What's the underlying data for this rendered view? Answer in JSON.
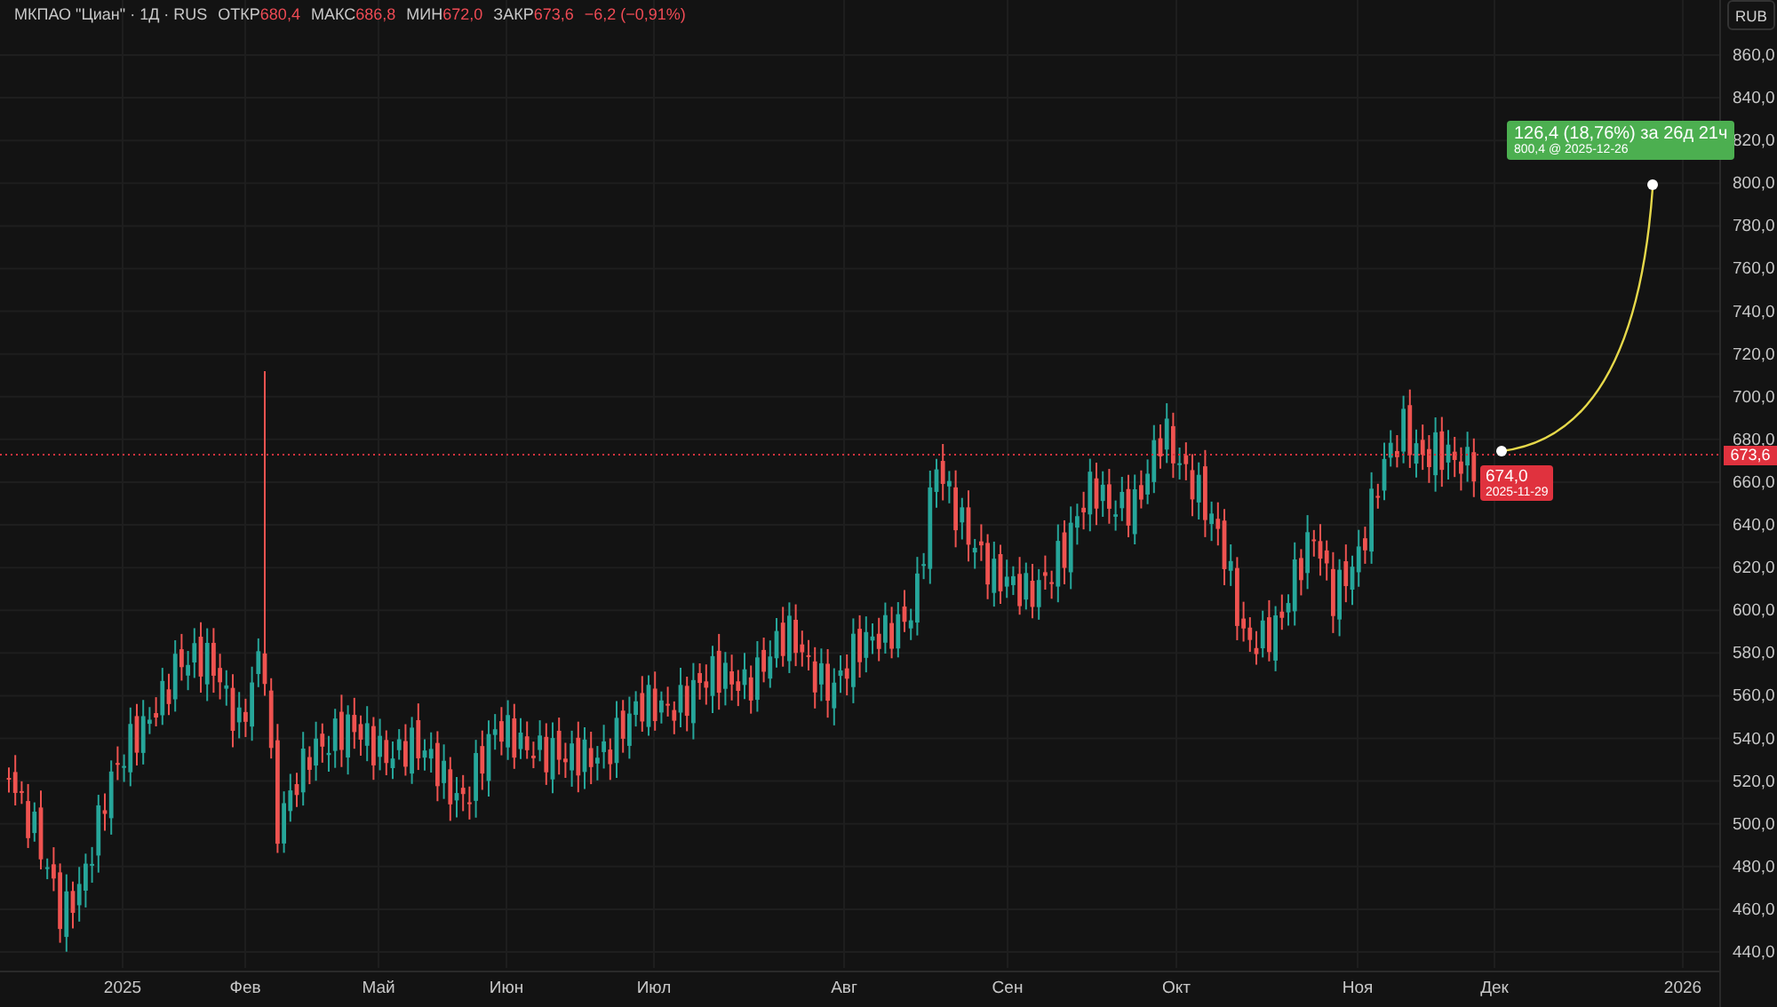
{
  "legend": {
    "title": "МКПАО \"Циан\" · 1Д · RUS",
    "items": [
      {
        "label": "ОТКР",
        "value": "680,4"
      },
      {
        "label": "МАКС",
        "value": "686,8"
      },
      {
        "label": "МИН",
        "value": "672,0"
      },
      {
        "label": "ЗАКР",
        "value": "673,6"
      }
    ],
    "change": "−6,2 (−0,91%)"
  },
  "currency_button": "RUB",
  "y_axis": [
    "860,0",
    "840,0",
    "820,0",
    "800,0",
    "780,0",
    "760,0",
    "740,0",
    "720,0",
    "700,0",
    "680,0",
    "660,0",
    "640,0",
    "620,0",
    "600,0",
    "580,0",
    "560,0",
    "540,0",
    "520,0",
    "500,0",
    "480,0",
    "460,0",
    "440,0"
  ],
  "x_axis": [
    "2025",
    "Фев",
    "Май",
    "Июн",
    "Июл",
    "Авг",
    "Сен",
    "Окт",
    "Ноя",
    "Дек",
    "2026"
  ],
  "last_price": "673,6",
  "forecast": {
    "start_price": "674,0",
    "start_date": "2025-11-29",
    "target_change": "126,4 (18,76%) за 26д 21ч",
    "target_detail": "800,4 @ 2025-12-26"
  }
}
